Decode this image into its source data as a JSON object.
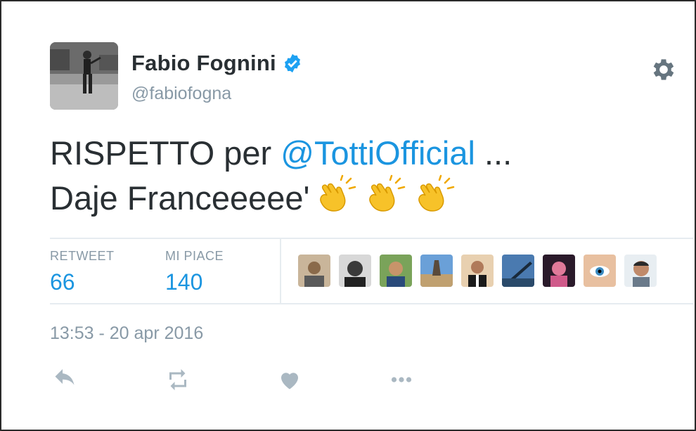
{
  "user": {
    "name": "Fabio Fognini",
    "handle": "@fabiofogna",
    "verified": true
  },
  "tweet": {
    "text_line1_prefix": "RISPETTO per ",
    "mention": "@TottiOfficial",
    "text_line1_suffix": " ...",
    "text_line2": "Daje Franceeeee'",
    "emojis": [
      "clapping-hands",
      "clapping-hands",
      "clapping-hands"
    ]
  },
  "stats": {
    "retweet_label": "RETWEET",
    "retweet_count": "66",
    "like_label": "MI PIACE",
    "like_count": "140"
  },
  "likers": [
    {
      "icon": "user-avatar-1"
    },
    {
      "icon": "user-avatar-2"
    },
    {
      "icon": "user-avatar-3"
    },
    {
      "icon": "user-avatar-4"
    },
    {
      "icon": "user-avatar-5"
    },
    {
      "icon": "user-avatar-6"
    },
    {
      "icon": "user-avatar-7"
    },
    {
      "icon": "user-avatar-8"
    },
    {
      "icon": "user-avatar-9"
    }
  ],
  "timestamp": "13:53 - 20 apr 2016",
  "colors": {
    "accent": "#1b95e0",
    "text": "#292f33",
    "muted": "#8899a6",
    "icons": "#aab8c2"
  },
  "actions": [
    "reply-icon",
    "retweet-icon",
    "like-icon",
    "more-icon"
  ]
}
